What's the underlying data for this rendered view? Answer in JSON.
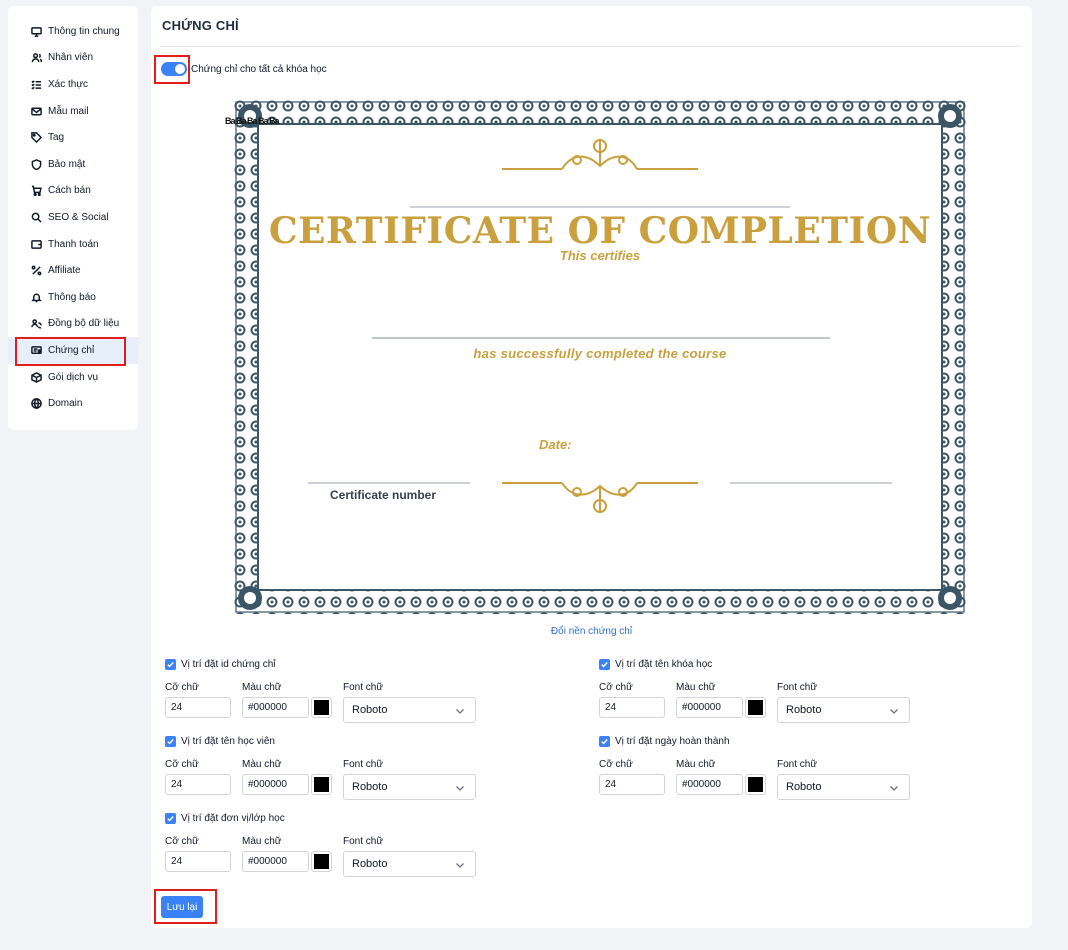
{
  "sidebar": {
    "items": [
      {
        "label": "Thông tin chung",
        "icon": "monitor-icon"
      },
      {
        "label": "Nhân viên",
        "icon": "users-icon"
      },
      {
        "label": "Xác thực",
        "icon": "checklist-icon"
      },
      {
        "label": "Mẫu mail",
        "icon": "mail-icon"
      },
      {
        "label": "Tag",
        "icon": "tag-icon"
      },
      {
        "label": "Bảo mật",
        "icon": "shield-icon"
      },
      {
        "label": "Cách bán",
        "icon": "cart-icon"
      },
      {
        "label": "SEO & Social",
        "icon": "search-icon"
      },
      {
        "label": "Thanh toán",
        "icon": "wallet-icon"
      },
      {
        "label": "Affiliate",
        "icon": "percent-icon"
      },
      {
        "label": "Thông báo",
        "icon": "bell-icon"
      },
      {
        "label": "Đồng bộ dữ liệu",
        "icon": "sync-users-icon"
      },
      {
        "label": "Chứng chỉ",
        "icon": "certificate-icon"
      },
      {
        "label": "Gói dịch vụ",
        "icon": "package-icon"
      },
      {
        "label": "Domain",
        "icon": "globe-icon"
      }
    ],
    "active_index": 12
  },
  "main": {
    "title": "CHỨNG CHỈ",
    "toggle": {
      "label": "Chứng chỉ cho tất cả khóa học",
      "enabled": true
    },
    "certificate": {
      "id_marker": "Ba Ba Ba Ba Ba",
      "title": "CERTIFICATE OF COMPLETION",
      "subtitle": "This certifies",
      "course_line": "has successfully completed the course",
      "date_label": "Date:",
      "number_label": "Certificate number"
    },
    "change_background": "Đổi nền chứng chỉ",
    "settings": [
      {
        "label": "Vị trí đặt id chứng chỉ",
        "checked": true,
        "size_label": "Cỡ chữ",
        "size": "24",
        "color_label": "Màu chữ",
        "color": "#000000",
        "font_label": "Font chữ",
        "font": "Roboto"
      },
      {
        "label": "Vị trí đặt tên khóa học",
        "checked": true,
        "size_label": "Cỡ chữ",
        "size": "24",
        "color_label": "Màu chữ",
        "color": "#000000",
        "font_label": "Font chữ",
        "font": "Roboto"
      },
      {
        "label": "Vị trí đặt tên học viên",
        "checked": true,
        "size_label": "Cỡ chữ",
        "size": "24",
        "color_label": "Màu chữ",
        "color": "#000000",
        "font_label": "Font chữ",
        "font": "Roboto"
      },
      {
        "label": "Vị trí đặt ngày hoàn thành",
        "checked": true,
        "size_label": "Cỡ chữ",
        "size": "24",
        "color_label": "Màu chữ",
        "color": "#000000",
        "font_label": "Font chữ",
        "font": "Roboto"
      },
      {
        "label": "Vị trí đặt đơn vị/lớp học",
        "checked": true,
        "size_label": "Cỡ chữ",
        "size": "24",
        "color_label": "Màu chữ",
        "color": "#000000",
        "font_label": "Font chữ",
        "font": "Roboto"
      }
    ],
    "save_label": "Lưu lại"
  },
  "colors": {
    "accent": "#3b82f6",
    "gold": "#c9a03d",
    "frame": "#3b5566",
    "highlight": "#e11d1d"
  }
}
